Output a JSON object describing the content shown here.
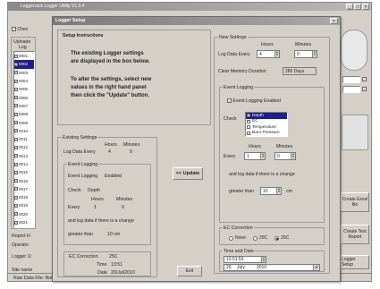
{
  "bg_window": {
    "title": "Loggerrack  Logger Utility V1.0.4",
    "chk_label": "Chec",
    "uploaded_label": "Uploade",
    "log_label": "Log",
    "items": [
      "0001",
      "0002",
      "0003",
      "0004",
      "0005",
      "0006",
      "0007",
      "0008",
      "0009",
      "0010",
      "0011",
      "0012",
      "0013",
      "0014",
      "0015",
      "0016",
      "0017",
      "0018",
      "0019",
      "0020",
      "0021"
    ],
    "report_label": "Report H",
    "operator_label": "Operato",
    "logger_label": "Logger 1/",
    "site_label": "Site name",
    "right_btn_excel": "Create Excel file",
    "right_btn_text": "Create Text Report",
    "right_btn_setup": "Logger Setup",
    "status_bar": "Raw Data File: Not Saved"
  },
  "dialog": {
    "title": "Logger Setup",
    "close": "×",
    "setup_instructions": {
      "title": "Setup Instructions",
      "line1": "The existing Logger settings",
      "line2": "are displayed in the box below.",
      "line3": "To alter the settings, select new",
      "line4": "values in the right hand panel",
      "line5": "then click the \"Update\" button."
    },
    "existing": {
      "title": "Existing Settings",
      "hours_label": "Hours",
      "minutes_label": "Minutes",
      "log_every_label": "Log Data Every",
      "hours_value": "4",
      "minutes_value": "0",
      "event_title": "Event Logging",
      "event_logging_label": "Event Logging",
      "event_logging_value": "Enabled",
      "check_label": "Check",
      "check_value": "Depth",
      "ev_hours_label": "Hours",
      "ev_minutes_label": "Minutes",
      "every_label": "Every",
      "ev_hours_value": "1",
      "ev_minutes_value": "0",
      "change_text": "and log data if there is a change",
      "greater_label": "greater than",
      "greater_value": "10 cm",
      "ec_label": "EC Correction",
      "ec_value": "25C",
      "time_label": "Time",
      "time_value": "13:51",
      "date_label": "Date",
      "date_value": "20/Jul/2010"
    },
    "update_button": "<< Update",
    "exit_button": "Exit",
    "new": {
      "title": "New Settings",
      "hours_label": "Hours",
      "minutes_label": "Minutes",
      "log_every_label": "Log Data Every",
      "hours_value": "4",
      "minutes_value": "0",
      "clear_label": "Clear Memory Duration",
      "clear_value": "280 Days",
      "event_title": "Event Logging",
      "event_enabled_label": "Event Logging Enabled",
      "check_label": "Check",
      "check_options": [
        "Depth",
        "EC",
        "Temperature",
        "Baro Pressure"
      ],
      "check_states": [
        true,
        false,
        false,
        false
      ],
      "ev_hours_label": "Hours",
      "ev_minutes_label": "Minutes",
      "every_label": "Every",
      "ev_hours_value": "1",
      "ev_minutes_value": "0",
      "change_text": "and log data if there is a change",
      "greater_label": "greater than",
      "greater_value": "10",
      "greater_unit": "cm",
      "ec_title": "EC Correction",
      "ec_options": [
        "None",
        "20C",
        "25C"
      ],
      "ec_selected": 2,
      "td_title": "Time and Date",
      "time_value": "13:51:53",
      "day_value": "20",
      "month_value": "July",
      "year_value": "2010"
    }
  }
}
